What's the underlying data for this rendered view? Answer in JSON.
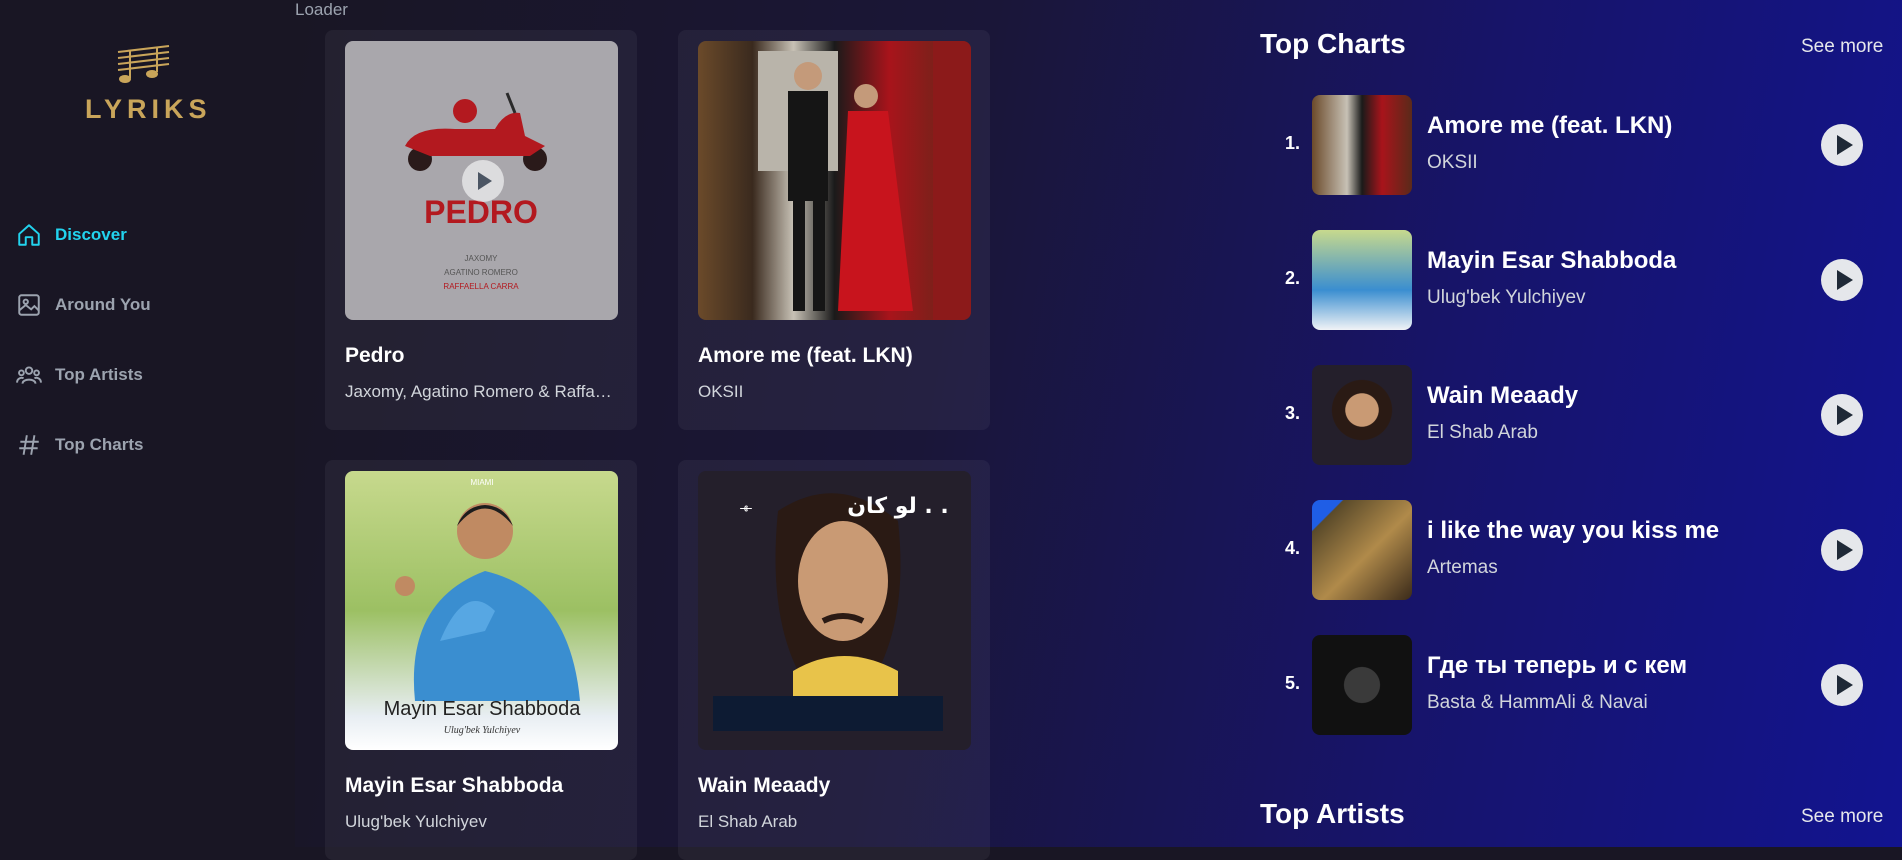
{
  "app": {
    "logo_text": "LYRIKS",
    "loader_text": "Loader"
  },
  "sidebar": {
    "items": [
      {
        "label": "Discover",
        "icon": "home-icon",
        "active": true
      },
      {
        "label": "Around You",
        "icon": "image-icon",
        "active": false
      },
      {
        "label": "Top Artists",
        "icon": "users-icon",
        "active": false
      },
      {
        "label": "Top Charts",
        "icon": "hashtag-icon",
        "active": false
      }
    ]
  },
  "songs": [
    {
      "title": "Pedro",
      "artist": "Jaxomy, Agatino Romero & Raffaella Carrà",
      "cover": {
        "brand": "PEDRO",
        "lines": [
          "JAXOMY",
          "AGATINO ROMERO",
          "RAFFAELLA CARRA"
        ]
      }
    },
    {
      "title": "Amore me (feat. LKN)",
      "artist": "OKSII"
    },
    {
      "title": "Mayin Esar Shabboda",
      "artist": "Ulug'bek Yulchiyev",
      "cover": {
        "brand": "MIAMI",
        "title": "Mayin Esar Shabboda",
        "sub": "Ulug'bek Yulchiyev"
      }
    },
    {
      "title": "Wain Meaady",
      "artist": "El Shab Arab",
      "cover": {
        "title": "لو كان . ."
      }
    }
  ],
  "top_charts": {
    "title": "Top Charts",
    "see_more": "See more",
    "items": [
      {
        "rank": "1.",
        "title": "Amore me (feat. LKN)",
        "artist": "OKSII"
      },
      {
        "rank": "2.",
        "title": "Mayin Esar Shabboda",
        "artist": "Ulug'bek Yulchiyev"
      },
      {
        "rank": "3.",
        "title": "Wain Meaady",
        "artist": "El Shab Arab"
      },
      {
        "rank": "4.",
        "title": "i like the way you kiss me",
        "artist": "Artemas"
      },
      {
        "rank": "5.",
        "title": "Где ты теперь и с кем",
        "artist": "Basta & HammAli & Navai"
      }
    ]
  },
  "top_artists": {
    "title": "Top Artists",
    "see_more": "See more"
  },
  "colors": {
    "accent": "#22d3ee",
    "sidebar_bg": "#191624",
    "logo_gold": "#c9a55a"
  }
}
